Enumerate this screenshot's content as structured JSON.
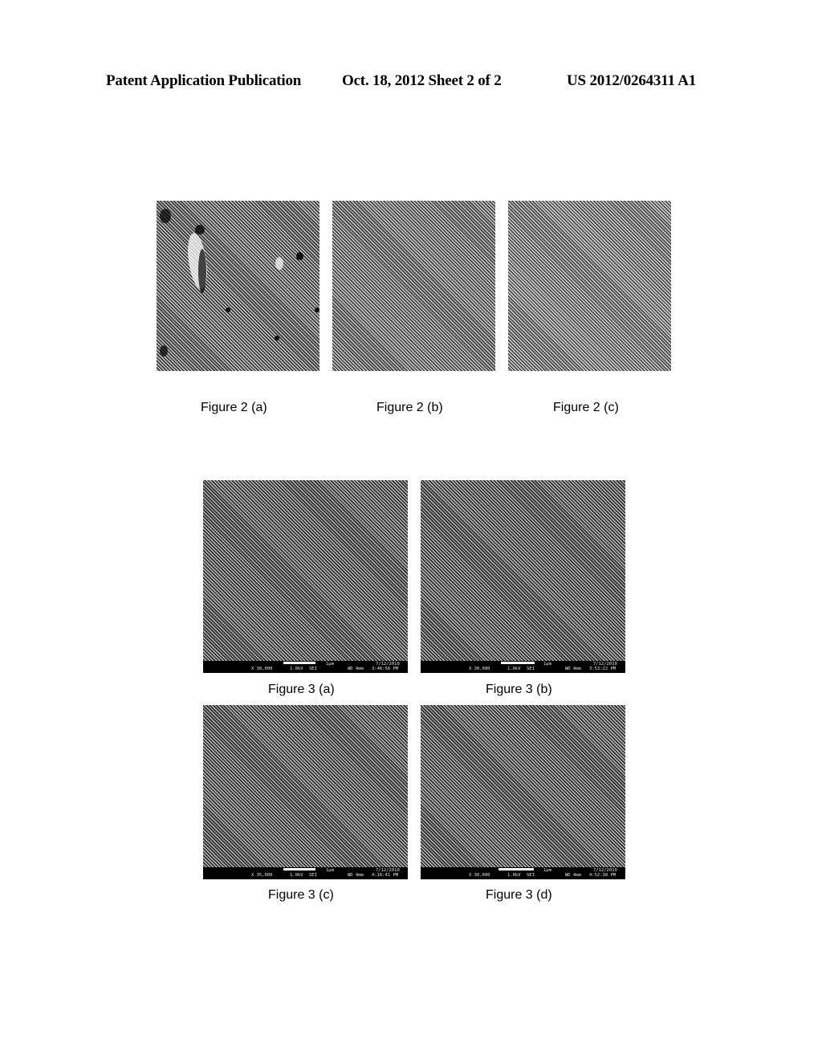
{
  "header": {
    "left": "Patent Application Publication",
    "date_sheet": "Oct. 18, 2012   Sheet 2 of 2",
    "pub_number": "US 2012/0264311 A1"
  },
  "figure2": {
    "panels": [
      {
        "id": "a",
        "caption": "Figure 2 (a)"
      },
      {
        "id": "b",
        "caption": "Figure 2 (b)"
      },
      {
        "id": "c",
        "caption": "Figure 2 (c)"
      }
    ]
  },
  "figure3": {
    "panels": [
      {
        "id": "a",
        "caption": "Figure 3 (a)",
        "info": {
          "mag": "X 30,000",
          "kv": "1.0kV",
          "det": "SEI",
          "scale": "1μm",
          "wd": "WD 4mm",
          "date": "7/12/2010",
          "time": "3:46:56 PM"
        }
      },
      {
        "id": "b",
        "caption": "Figure 3 (b)",
        "info": {
          "mag": "X 30,000",
          "kv": "1.0kV",
          "det": "SEI",
          "scale": "1μm",
          "wd": "WD 4mm",
          "date": "7/12/2010",
          "time": "3:53:22 PM"
        }
      },
      {
        "id": "c",
        "caption": "Figure 3 (c)",
        "info": {
          "mag": "X 35,000",
          "kv": "1.0kV",
          "det": "SEI",
          "scale": "1μm",
          "wd": "WD 4mm",
          "date": "7/12/2010",
          "time": "4:16:41 PM"
        }
      },
      {
        "id": "d",
        "caption": "Figure 3 (d)",
        "info": {
          "mag": "X 30,000",
          "kv": "1.0kV",
          "det": "SEI",
          "scale": "1μm",
          "wd": "WD 4mm",
          "date": "7/12/2010",
          "time": "4:52:38 PM"
        }
      }
    ]
  }
}
